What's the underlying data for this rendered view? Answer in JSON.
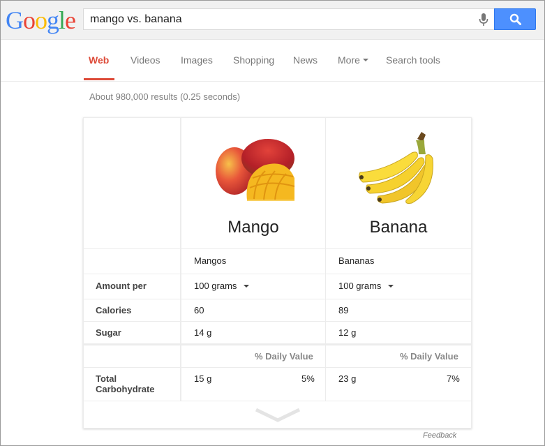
{
  "logo": {
    "letters": [
      "G",
      "o",
      "o",
      "g",
      "l",
      "e"
    ],
    "colors": [
      "#4285f4",
      "#ea4335",
      "#fbbc05",
      "#4285f4",
      "#34a853",
      "#ea4335"
    ]
  },
  "search": {
    "query": "mango vs. banana"
  },
  "tabs": [
    {
      "label": "Web",
      "active": true
    },
    {
      "label": "Videos"
    },
    {
      "label": "Images"
    },
    {
      "label": "Shopping"
    },
    {
      "label": "News"
    },
    {
      "label": "More",
      "has_caret": true
    },
    {
      "label": "Search tools"
    }
  ],
  "stats": "About 980,000 results (0.25 seconds)",
  "comparison": {
    "fruits": [
      {
        "name": "Mango",
        "variety": "Mangos",
        "amount": "100 grams",
        "calories": "60",
        "sugar": "14 g",
        "carb": "15 g",
        "carb_dv": "5%"
      },
      {
        "name": "Banana",
        "variety": "Bananas",
        "amount": "100 grams",
        "calories": "89",
        "sugar": "12 g",
        "carb": "23 g",
        "carb_dv": "7%"
      }
    ],
    "row_labels": {
      "amount": "Amount per",
      "calories": "Calories",
      "sugar": "Sugar",
      "carb_line1": "Total",
      "carb_line2": "Carbohydrate"
    },
    "daily_value_header": "% Daily Value"
  },
  "feedback": "Feedback",
  "colors": {
    "accent": "#dd4b39",
    "button_blue": "#4d90fe"
  }
}
